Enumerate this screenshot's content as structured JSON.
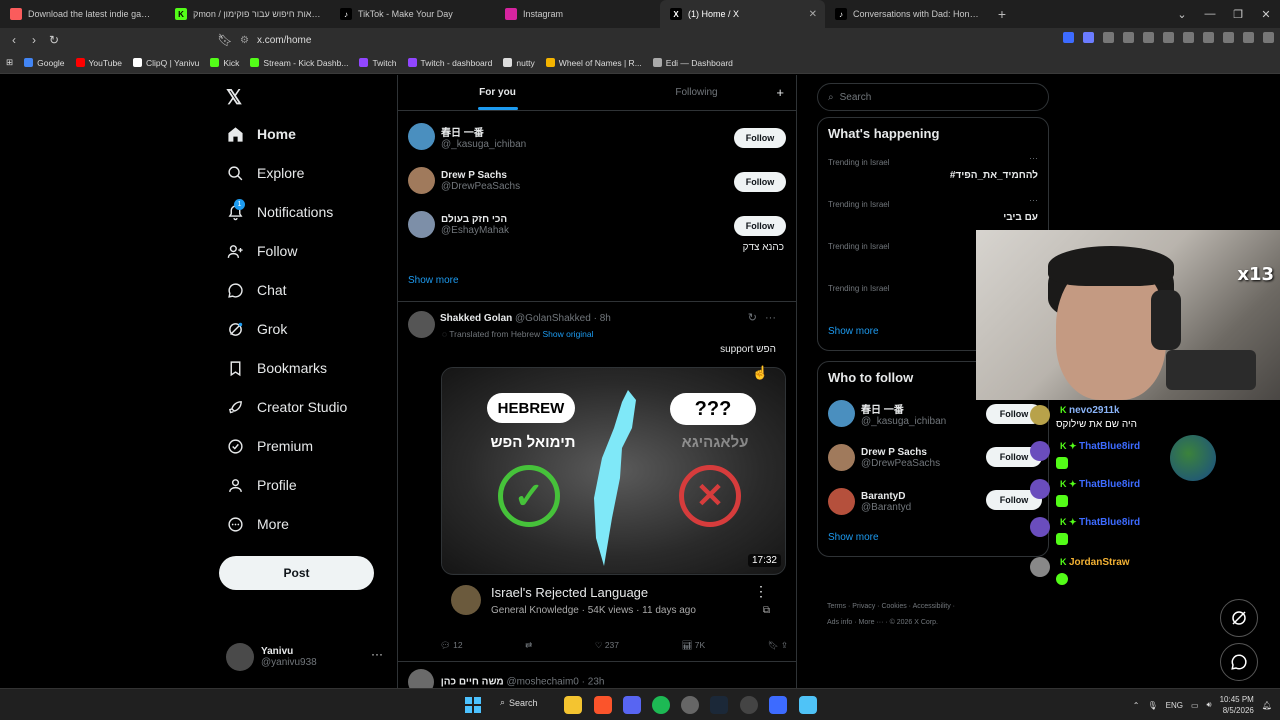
{
  "browser": {
    "tabs": [
      {
        "title": "Download the latest indie games - it...",
        "fav_color": "#fa5c5c",
        "active": false
      },
      {
        "title": "קmon / חוצאות חיפוש עבור פוקימון",
        "fav_color": "#53fc18",
        "active": false
      },
      {
        "title": "TikTok - Make Your Day",
        "fav_color": "#222222",
        "active": false
      },
      {
        "title": "Instagram",
        "fav_color": "#d6249f",
        "active": false
      },
      {
        "title": "(1) Home / X",
        "fav_color": "#000000",
        "active": true
      },
      {
        "title": "Conversations with Dad: Honest Que...",
        "fav_color": "#222222",
        "active": false
      }
    ],
    "url": "x.com/home",
    "bookmarks": [
      {
        "label": "Google",
        "color": "#4285f4"
      },
      {
        "label": "YouTube",
        "color": "#ff0000"
      },
      {
        "label": "ClipQ | Yanivu",
        "color": "#ffffff"
      },
      {
        "label": "Kick",
        "color": "#53fc18"
      },
      {
        "label": "Stream - Kick Dashb...",
        "color": "#53fc18"
      },
      {
        "label": "Twitch",
        "color": "#9146ff"
      },
      {
        "label": "Twitch - dashboard",
        "color": "#9146ff"
      },
      {
        "label": "nutty",
        "color": "#dddddd"
      },
      {
        "label": "Wheel of Names | R...",
        "color": "#f4b400"
      },
      {
        "label": "Edi — Dashboard",
        "color": "#aaaaaa"
      }
    ]
  },
  "sidebar": {
    "items": [
      {
        "label": "Home",
        "icon": "home-icon"
      },
      {
        "label": "Explore",
        "icon": "search-icon"
      },
      {
        "label": "Notifications",
        "icon": "bell-icon",
        "badge": "1"
      },
      {
        "label": "Follow",
        "icon": "person-plus-icon"
      },
      {
        "label": "Chat",
        "icon": "chat-icon"
      },
      {
        "label": "Grok",
        "icon": "grok-icon"
      },
      {
        "label": "Bookmarks",
        "icon": "bookmark-icon"
      },
      {
        "label": "Creator Studio",
        "icon": "rocket-icon"
      },
      {
        "label": "Premium",
        "icon": "verified-icon"
      },
      {
        "label": "Profile",
        "icon": "person-icon"
      },
      {
        "label": "More",
        "icon": "more-circle-icon"
      }
    ],
    "post_label": "Post",
    "account": {
      "name": "Yanivu",
      "handle": "@yanivu938"
    }
  },
  "feed": {
    "tabs": [
      "For you",
      "Following"
    ],
    "who_to_follow_inline": [
      {
        "name": "春日 一番",
        "handle": "@_kasuga_ichiban",
        "avatar_color": "#4a8fbf"
      },
      {
        "name": "Drew P Sachs",
        "handle": "@DrewPeaSachs",
        "avatar_color": "#a07a5c"
      },
      {
        "name": "הכי חזק בעולם",
        "handle": "@EshayMahak",
        "avatar_color": "#7d8fa8"
      }
    ],
    "follow_label": "Follow",
    "inline_bio": "כהנא צדק",
    "show_more": "Show more",
    "post": {
      "name": "Shakked Golan",
      "handle": "@GolanShakked",
      "time": "8h",
      "translated": "Translated from Hebrew",
      "show_original": "Show original",
      "text": "support הפש",
      "video": {
        "bubble_left": "HEBREW",
        "hebrew_left": "תימואל הפש",
        "bubble_right": "???",
        "hebrew_right": "עלאגהיגא",
        "duration": "17:32",
        "title": "Israel's Rejected Language",
        "channel": "General Knowledge",
        "views": "54K views",
        "age": "11 days ago",
        "meta": "General Knowledge · 54K views · 11 days ago"
      },
      "replies": "12",
      "reposts": "",
      "likes": "237",
      "views": "7K"
    },
    "next_post": {
      "name": "משה חיים כהן",
      "handle": "@moshechaim0",
      "time": "23h"
    }
  },
  "right": {
    "search_placeholder": "Search",
    "whats_happening": "What's happening",
    "trends": [
      {
        "label": "Trending in Israel",
        "topic": "#להחמיד_את_הפיד"
      },
      {
        "label": "Trending in Israel",
        "topic": "עם ביבי"
      },
      {
        "label": "Trending in Israel",
        "topic": ""
      },
      {
        "label": "Trending in Israel",
        "topic": "ת"
      }
    ],
    "show_more": "Show more",
    "who_to_follow": "Who to follow",
    "suggestions": [
      {
        "name": "春日 一番",
        "handle": "@_kasuga_ichiban",
        "avatar_color": "#4a8fbf"
      },
      {
        "name": "Drew P Sachs",
        "handle": "@DrewPeaSachs",
        "avatar_color": "#a07a5c"
      },
      {
        "name": "BarantyD",
        "handle": "@Barantyd",
        "avatar_color": "#b5503c"
      }
    ],
    "footer_line1": "Terms · Privacy · Cookies · Accessibility ·",
    "footer_line2": "Ads info · More ··· · © 2026 X Corp."
  },
  "overlay": {
    "cam_badge": "x13",
    "chat": [
      {
        "user": "nevo2911k",
        "text": "היה שם את שילוקס",
        "color": "#8ab4f8"
      },
      {
        "user": "ThatBlue8ird",
        "text": "",
        "color": "#3d6bff"
      },
      {
        "user": "ThatBlue8ird",
        "text": "",
        "color": "#3d6bff"
      },
      {
        "user": "ThatBlue8ird",
        "text": "",
        "color": "#3d6bff"
      },
      {
        "user": "JordanStraw",
        "text": "",
        "color": "#f2b134"
      }
    ]
  },
  "taskbar": {
    "search_label": "Search",
    "lang": "ENG",
    "time": "10:45 PM",
    "date": "8/5/2026"
  }
}
